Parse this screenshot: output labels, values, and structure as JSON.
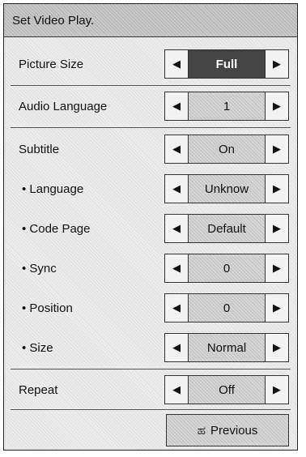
{
  "title": "Set Video Play.",
  "rows": [
    {
      "label": "Picture Size",
      "value": "Full"
    },
    {
      "label": "Audio Language",
      "value": "1"
    },
    {
      "label": "Subtitle",
      "value": "On"
    },
    {
      "label": "• Language",
      "value": "Unknow"
    },
    {
      "label": "• Code Page",
      "value": "Default"
    },
    {
      "label": "• Sync",
      "value": "0"
    },
    {
      "label": "• Position",
      "value": "0"
    },
    {
      "label": "• Size",
      "value": "Normal"
    },
    {
      "label": "Repeat",
      "value": "Off"
    }
  ],
  "arrows": {
    "left": "◀",
    "right": "▶"
  },
  "previous": {
    "icon": "return-icon",
    "glyph": "ಹ",
    "label": "Previous"
  },
  "colors": {
    "selected_value_bg": "#444444",
    "panel_bg": "#ededed"
  }
}
